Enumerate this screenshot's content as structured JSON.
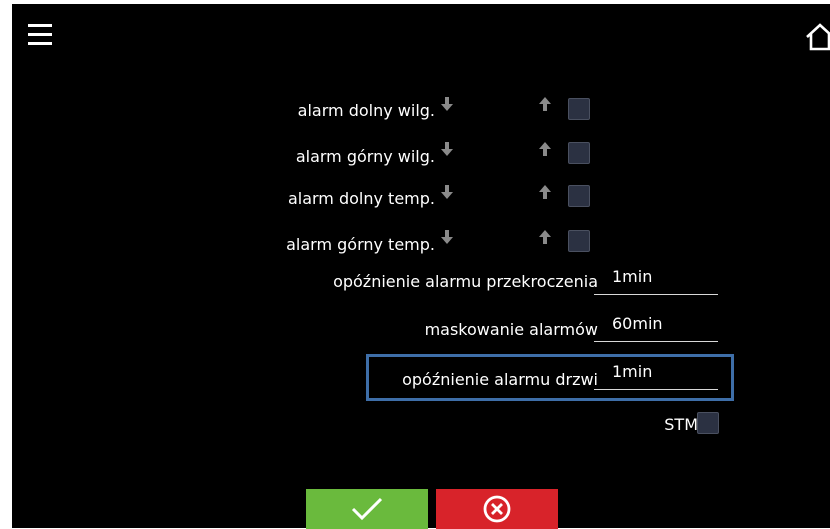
{
  "header": {
    "menu_icon": "hamburger-menu-icon",
    "home_icon": "home-icon"
  },
  "alarms": [
    {
      "label": "alarm dolny wilg.",
      "checked": false
    },
    {
      "label": "alarm górny wilg.",
      "checked": false
    },
    {
      "label": "alarm dolny temp.",
      "checked": false
    },
    {
      "label": "alarm górny temp.",
      "checked": false
    }
  ],
  "settings": [
    {
      "label": "opóźnienie alarmu przekroczenia",
      "value": "1min"
    },
    {
      "label": "maskowanie alarmów",
      "value": "60min"
    },
    {
      "label": "opóźnienie alarmu drzwi",
      "value": "1min",
      "focused": true
    }
  ],
  "stm": {
    "label": "STM",
    "checked": false
  },
  "buttons": {
    "confirm_icon": "checkmark-icon",
    "cancel_icon": "cancel-circle-icon"
  },
  "colors": {
    "background": "#000000",
    "confirm": "#6aba3d",
    "cancel": "#d8232a",
    "focus": "#3e6ea8",
    "checkbox": "#2b3142"
  }
}
